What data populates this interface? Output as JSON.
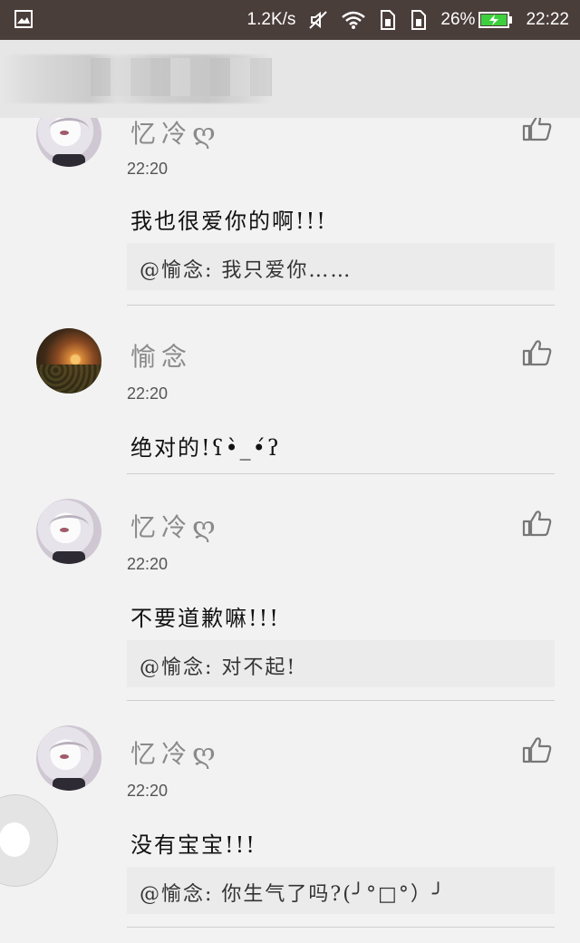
{
  "statusbar": {
    "speed": "1.2K/s",
    "battery": "26%",
    "time": "22:22",
    "icons": [
      "image-icon",
      "mute-icon",
      "wifi-icon",
      "sim1-icon",
      "sim2-icon",
      "battery-charging-icon"
    ]
  },
  "comments": [
    {
      "name": "忆冷",
      "name_suffix": "ღ",
      "time": "22:20",
      "text": "我也很爱你的啊!!!",
      "reply": "@愉念: 我只爱你……",
      "avatar": "anime"
    },
    {
      "name": "愉念",
      "name_suffix": "",
      "time": "22:20",
      "text": "绝对的!ʕ•̀_•́ʔ",
      "reply": "",
      "avatar": "sunset"
    },
    {
      "name": "忆冷",
      "name_suffix": "ღ",
      "time": "22:20",
      "text": "不要道歉嘛!!!",
      "reply": "@愉念: 对不起!",
      "avatar": "anime"
    },
    {
      "name": "忆冷",
      "name_suffix": "ღ",
      "time": "22:20",
      "text": "没有宝宝!!!",
      "reply": "@愉念: 你生气了吗?(╯°□°）╯",
      "avatar": "anime"
    }
  ]
}
